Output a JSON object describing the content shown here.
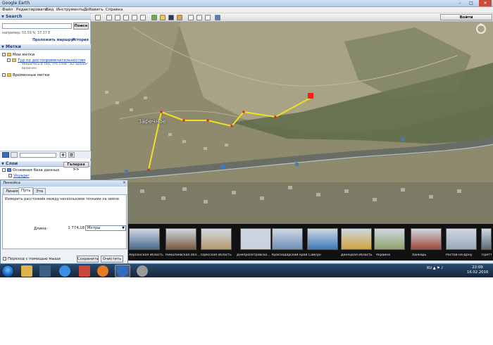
{
  "window": {
    "title": "Google Earth",
    "minimize": "–",
    "maximize": "□",
    "close": "✕"
  },
  "menu": [
    "Файл",
    "Редактировать",
    "Вид",
    "Инструменты",
    "Добавить",
    "Справка"
  ],
  "search": {
    "header": "Search",
    "input_value": "",
    "button": "Поиск",
    "hint": "например: 55.59 N, 37.37 E",
    "route_link": "Проложить маршрут",
    "history_link": "История"
  },
  "places": {
    "header": "Метки",
    "my_places": "Мои метки",
    "tour_link": "Тур по достопримечательностям",
    "tour_note_1": "Убедитесь в том, что слой \"3D-здания\"",
    "tour_note_2": "включен",
    "temporary": "Временные метки"
  },
  "layers": {
    "header": "Слои",
    "gallery_button": "Галерея >>",
    "primary_db": "Основная база данных",
    "voyager": "Voyager"
  },
  "toolbar": {
    "signin": "Войти"
  },
  "map": {
    "town_label": "Заречное",
    "compass_letter": "N"
  },
  "tour": {
    "thumbs": [
      {
        "label": "Херсонская область",
        "color": "#4a6a8c"
      },
      {
        "label": "Николаевская обл...",
        "color": "#7c5a3c"
      },
      {
        "label": "Одесская область",
        "color": "#b89a6a"
      },
      {
        "label": "Днепропетровска...",
        "color": "#c7d0da"
      },
      {
        "label": "Краснодарский край",
        "color": "#6d8fb8"
      },
      {
        "label": "Самсун",
        "color": "#3a7ab8"
      },
      {
        "label": "Донецкая область",
        "color": "#d0a23a"
      },
      {
        "label": "Украина",
        "color": "#8ea26a"
      },
      {
        "label": "Ханкарь",
        "color": "#a04a3a"
      },
      {
        "label": "Ростов-на-Дону",
        "color": "#9aa8b8"
      },
      {
        "label": "Претт",
        "color": "#5a6a7a"
      }
    ]
  },
  "ruler": {
    "title": "Линейка",
    "tabs": [
      "Линия",
      "Путь",
      "Эта"
    ],
    "description": "Измерить расстояние между несколькими точками на земле",
    "length_label": "Длина:",
    "length_value": "1 774,18",
    "unit": "Метры",
    "mouse_nav": "Переход с помощью мыши",
    "save": "Сохранить",
    "clear": "Очистить"
  },
  "taskbar": {
    "time": "22:09",
    "date": "16.02.2016",
    "tray": "RU ▲ ⚑ ♪",
    "apps": [
      "explorer-icon",
      "windows-media-icon",
      "ie-icon",
      "paint-icon",
      "firefox-icon",
      "google-earth-icon",
      "media-player-icon"
    ]
  }
}
